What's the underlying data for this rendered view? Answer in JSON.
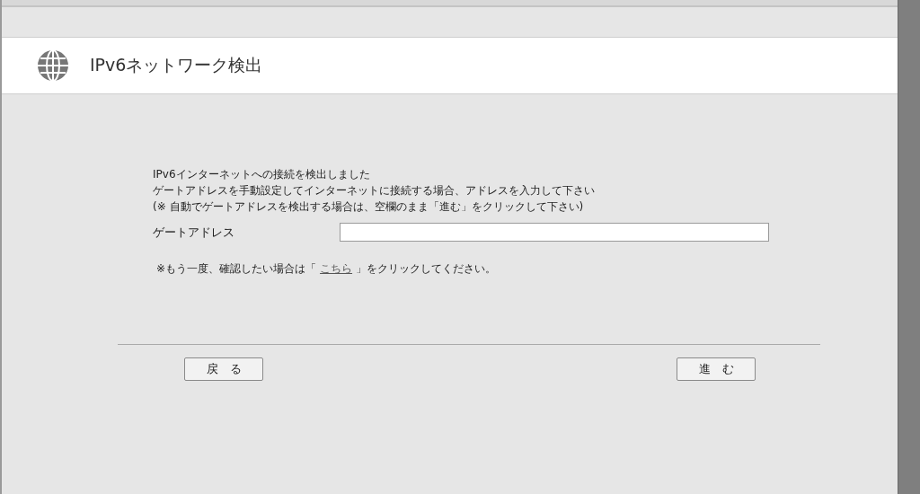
{
  "header": {
    "title": "IPv6ネットワーク検出"
  },
  "messages": [
    "IPv6インターネットへの接続を検出しました",
    "ゲートアドレスを手動設定してインターネットに接続する場合、アドレスを入力して下さい",
    "(※ 自動でゲートアドレスを検出する場合は、空欄のまま「進む」をクリックして下さい)"
  ],
  "field": {
    "label": "ゲートアドレス"
  },
  "retry": {
    "before": "※もう一度、確認したい場合は「",
    "link": "こちら",
    "after": "」をクリックしてください。"
  },
  "buttons": [
    "戻　る",
    "進　む"
  ]
}
